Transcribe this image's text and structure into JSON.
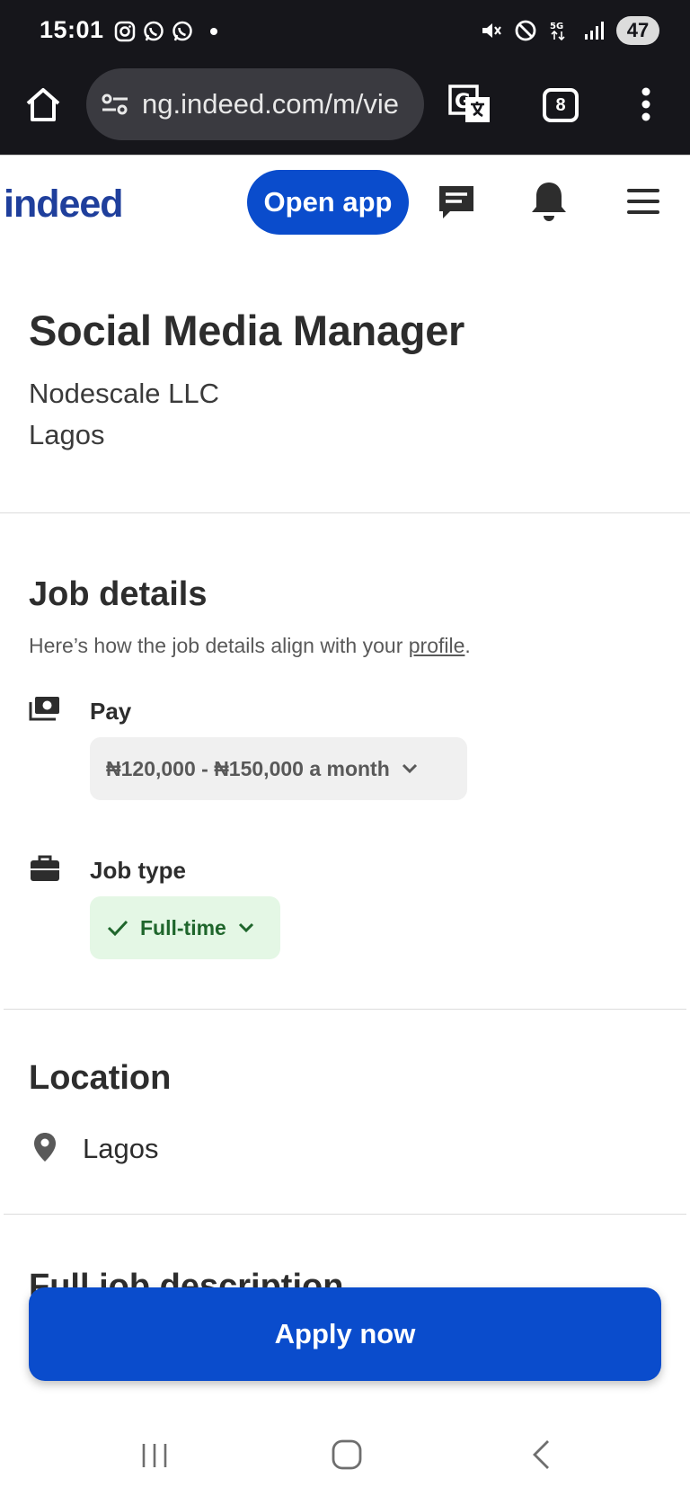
{
  "status_bar": {
    "time": "15:01",
    "battery": "47",
    "network": "5G"
  },
  "browser": {
    "url": "ng.indeed.com/m/vie",
    "tab_count": "8"
  },
  "header": {
    "logo_text": "indeed",
    "open_app_label": "Open app"
  },
  "job": {
    "title": "Social Media Manager",
    "company": "Nodescale LLC",
    "location": "Lagos"
  },
  "job_details": {
    "heading": "Job details",
    "subtitle_prefix": "Here’s how the job details align with your ",
    "subtitle_link": "profile",
    "subtitle_suffix": ".",
    "pay_label": "Pay",
    "pay_value": "₦120,000 - ₦150,000 a month",
    "job_type_label": "Job type",
    "job_type_value": "Full-time"
  },
  "location_section": {
    "heading": "Location",
    "value": "Lagos"
  },
  "description": {
    "heading": "Full job description"
  },
  "apply_label": "Apply now",
  "colors": {
    "brand_blue": "#0a4ccc",
    "logo_blue": "#1f3f9c",
    "pill_green_bg": "#e4f7e5",
    "pill_green_text": "#1f662c"
  }
}
